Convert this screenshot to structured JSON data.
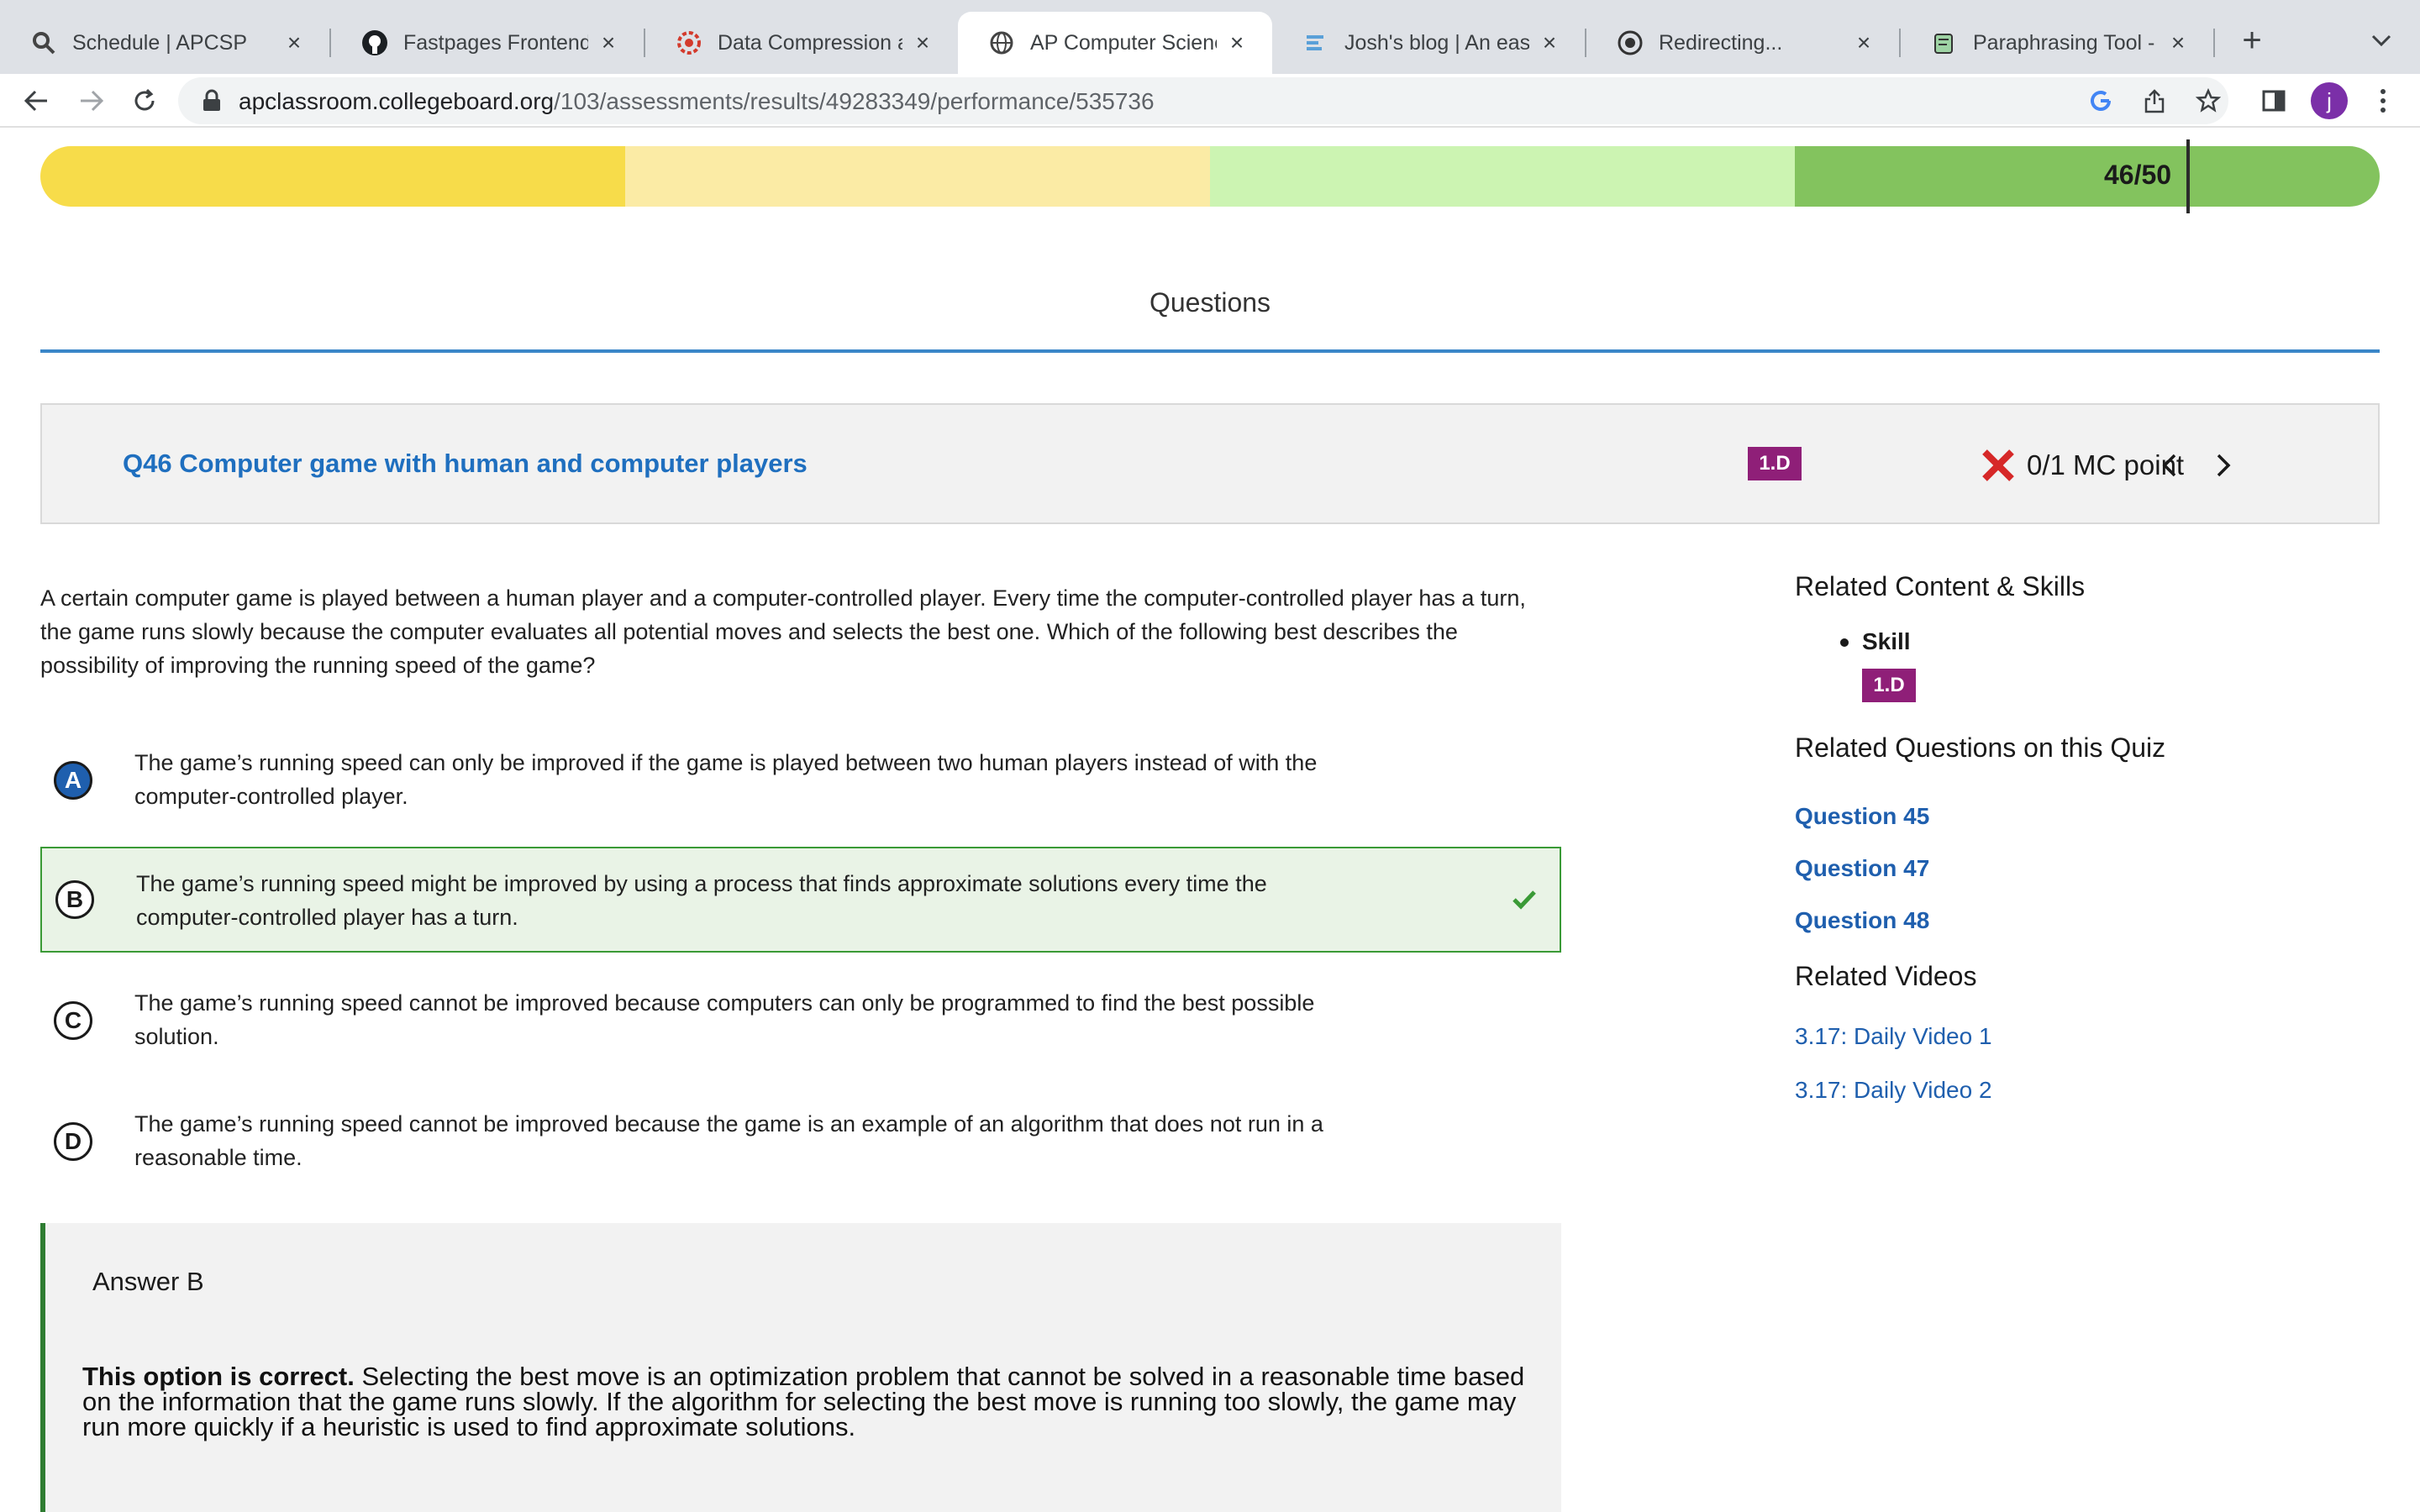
{
  "browser": {
    "tabs": [
      {
        "title": "Schedule | APCSP",
        "favicon": "apcsp-favicon-icon",
        "active": false
      },
      {
        "title": "Fastpages Frontend D",
        "favicon": "github-icon",
        "active": false
      },
      {
        "title": "Data Compression an",
        "favicon": "red-gear-favicon-icon",
        "active": false
      },
      {
        "title": "AP Computer Science",
        "favicon": "globe-icon",
        "active": true
      },
      {
        "title": "Josh's blog | An easy",
        "favicon": "blog-favicon-icon",
        "active": false
      },
      {
        "title": "Redirecting...",
        "favicon": "redirect-favicon-icon",
        "active": false
      },
      {
        "title": "Paraphrasing Tool - AI",
        "favicon": "paraphrase-favicon-icon",
        "active": false
      }
    ],
    "url_host": "apclassroom.collegeboard.org",
    "url_path": "/103/assessments/results/49283349/performance/535736",
    "profile_initial": "j"
  },
  "score_bar": {
    "score": "46/50",
    "colors": [
      "#f7dc4a",
      "#fbeba5",
      "#ccf4b2",
      "#83c35e"
    ]
  },
  "questions_tab": "Questions",
  "question": {
    "title": "Q46 Computer game with human and computer players",
    "skill": "1.D",
    "points": "0/1 MC point",
    "stem": "A certain computer game is played between a human player and a computer-controlled player. Every time the computer-controlled player has a turn, the game runs slowly because the computer evaluates all potential moves and selects the best one. Which of the following best describes the possibility of improving the running speed of the game?",
    "options": [
      {
        "letter": "A",
        "text": "The game’s running speed can only be improved if the game is played between two human players instead of with the computer-controlled player."
      },
      {
        "letter": "B",
        "text": "The game’s running speed might be improved by using a process that finds approximate solutions every time the computer-controlled player has a turn."
      },
      {
        "letter": "C",
        "text": "The game’s running speed cannot be improved because computers can only be programmed to find the best possible solution."
      },
      {
        "letter": "D",
        "text": "The game’s running speed cannot be improved because the game is an example of an algorithm that does not run in a reasonable time."
      }
    ],
    "selected": "A",
    "correct": "B"
  },
  "answer": {
    "heading": "Answer B",
    "lead": "This option is correct.",
    "explanation": " Selecting the best move is an optimization problem that cannot be solved in a reasonable time based on the information that the game runs slowly. If the algorithm for selecting the best move is running too slowly, the game may run more quickly if a heuristic is used to find approximate solutions."
  },
  "sidebar": {
    "related_content_heading": "Related Content & Skills",
    "skill_label": "Skill",
    "skill_badge": "1.D",
    "related_questions_heading": "Related Questions on this Quiz",
    "related_questions": [
      "Question 45",
      "Question 47",
      "Question 48"
    ],
    "related_videos_heading": "Related Videos",
    "related_videos": [
      "3.17: Daily Video 1",
      "3.17: Daily Video 2"
    ]
  }
}
